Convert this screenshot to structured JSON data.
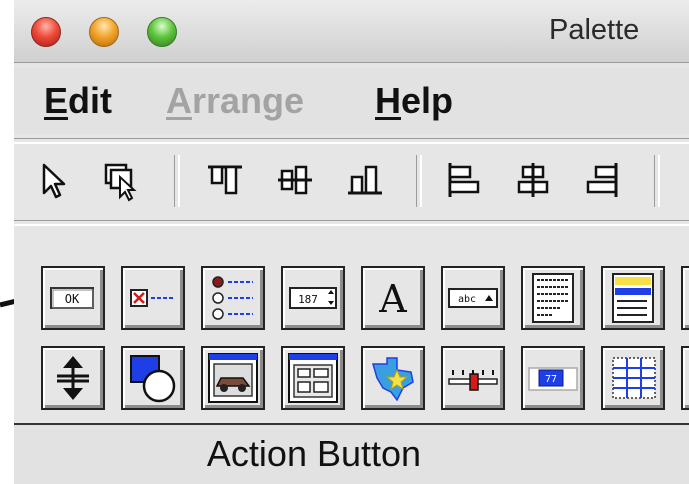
{
  "window": {
    "title": "Palette"
  },
  "menubar": {
    "edit": {
      "first": "E",
      "rest": "dit"
    },
    "arrange": {
      "first": "A",
      "rest": "rrange"
    },
    "help": {
      "first": "H",
      "rest": "elp"
    }
  },
  "toolbar": {
    "tools": [
      "select-arrow-icon",
      "multi-select-icon",
      "align-top-icon",
      "align-vertical-center-icon",
      "align-bottom-icon",
      "align-left-icon",
      "align-horizontal-center-icon",
      "align-right-icon"
    ]
  },
  "palette": {
    "row1": [
      {
        "icon": "action-button-icon",
        "text": "OK"
      },
      {
        "icon": "checkbox-icon"
      },
      {
        "icon": "radio-group-icon"
      },
      {
        "icon": "spinner-field-icon",
        "text": "187"
      },
      {
        "icon": "text-label-icon",
        "text": "A"
      },
      {
        "icon": "combo-box-icon",
        "text": "abc"
      },
      {
        "icon": "text-area-icon"
      },
      {
        "icon": "list-box-icon"
      }
    ],
    "row2": [
      {
        "icon": "splitter-icon"
      },
      {
        "icon": "shapes-icon"
      },
      {
        "icon": "image-window-icon"
      },
      {
        "icon": "form-window-icon"
      },
      {
        "icon": "map-icon"
      },
      {
        "icon": "slider-icon"
      },
      {
        "icon": "numeric-display-icon",
        "text": "77"
      },
      {
        "icon": "table-grid-icon"
      }
    ]
  },
  "status": {
    "text": "Action Button"
  },
  "colors": {
    "window_bg": "#e6e6e6",
    "accent_blue": "#1f3fe6",
    "accent_yellow": "#f5e04a",
    "accent_red": "#d21b1b"
  }
}
